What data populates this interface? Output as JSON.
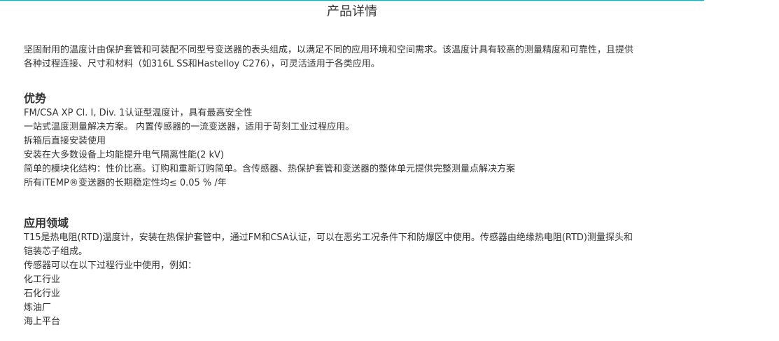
{
  "page": {
    "title": "产品详情"
  },
  "intro": "坚固耐用的温度计由保护套管和可装配不同型号变送器的表头组成，以满足不同的应用环境和空间需求。该温度计具有较高的测量精度和可靠性，且提供各种过程连接、尺寸和材料（如316L SS和Hastelloy C276），可灵活适用于各类应用。",
  "intro_lines": [
    "坚固耐用的温度计由保护套管和可装配不同型号变送器的表头组成，以满足不同的应用环境和空间需求。该温度计具有较高的测量精度和可靠性，且提供",
    "各种过程连接、尺寸和材料（如316L SS和Hastelloy C276），可灵活适用于各类应用。"
  ],
  "advantages": {
    "title": "优势",
    "items": [
      "FM/CSA XP Cl. I, Div. 1认证型温度计，具有最高安全性",
      "一站式温度测量解决方案。 内置传感器的一流变送器，适用于苛刻工业过程应用。",
      "拆箱后直接安装使用",
      "安装在大多数设备上均能提升电气隔离性能(2 kV)",
      "简单的模块化结构：性价比高。订购和重新订购简单。含传感器、热保护套管和变送器的整体单元提供完整测量点解决方案",
      "所有iTEMP®变送器的长期稳定性均≤ 0.05 % /年"
    ]
  },
  "applications": {
    "title": "应用领域",
    "lines": [
      "T15是热电阻(RTD)温度计，安装在热保护套管中，通过FM和CSA认证，可以在恶劣工况条件下和防爆区中使用。传感器由绝缘热电阻(RTD)测量探头和",
      "铠装芯子组成。",
      "传感器可以在以下过程行业中使用，例如：",
      "化工行业",
      "石化行业",
      "炼油厂",
      "海上平台"
    ]
  }
}
